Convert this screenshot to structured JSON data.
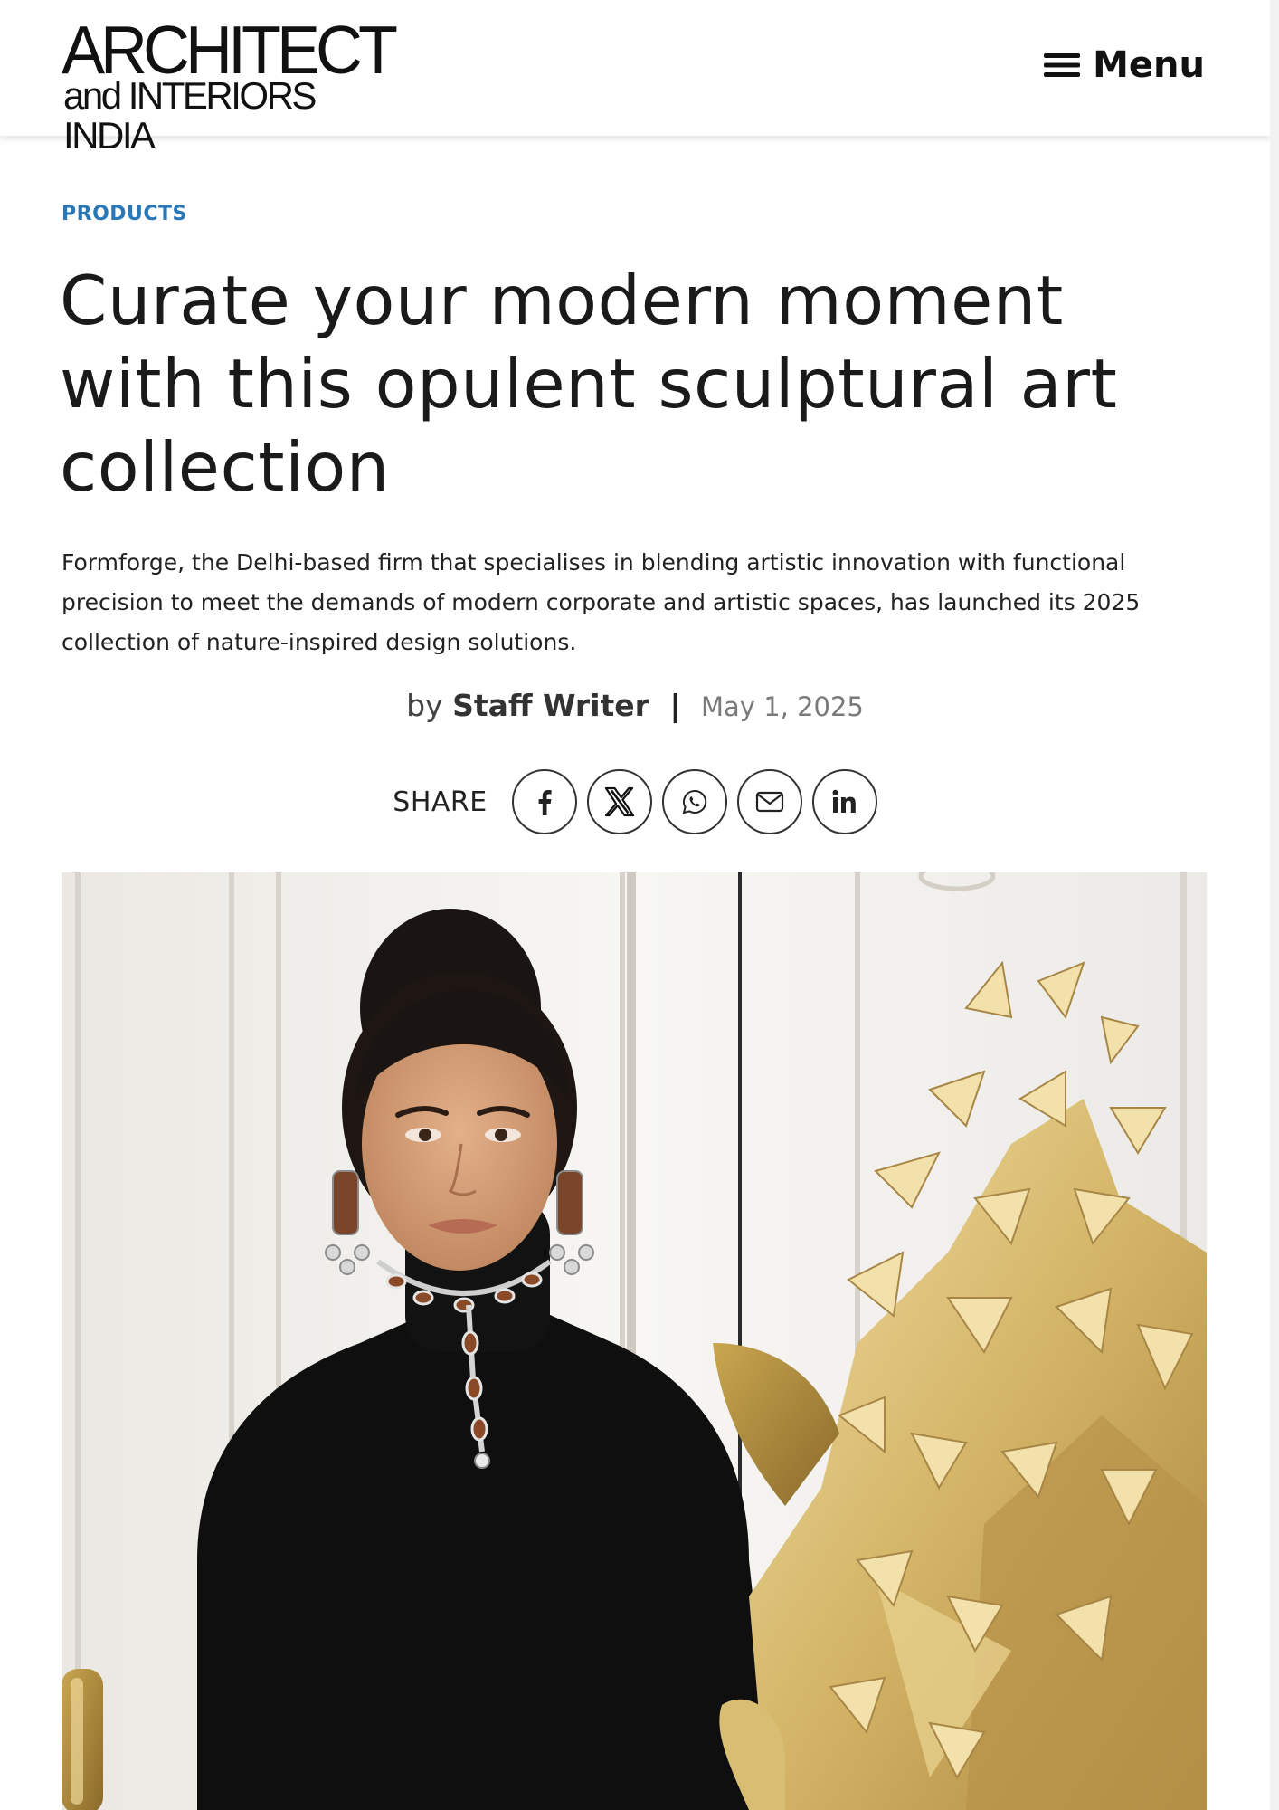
{
  "header": {
    "logo_line_1": "ARCHITECT",
    "logo_line_2": "and INTERIORS INDIA",
    "menu_label": "Menu",
    "menu_icon": "hamburger-icon"
  },
  "article": {
    "category": "PRODUCTS",
    "headline": "Curate your modern moment with this opulent sculptural art collection",
    "dek": "Formforge, the Delhi-based firm that specialises in blending artistic innovation with functional precision to meet the demands of modern corporate and artistic spaces, has launched its 2025 collection of nature-inspired design solutions.",
    "byline_prefix": "by",
    "author": "Staff Writer",
    "separator": "|",
    "date": "May 1, 2025"
  },
  "share": {
    "label": "SHARE",
    "buttons": [
      {
        "name": "facebook",
        "icon": "facebook-icon"
      },
      {
        "name": "x",
        "icon": "x-icon"
      },
      {
        "name": "whatsapp",
        "icon": "whatsapp-icon"
      },
      {
        "name": "email",
        "icon": "email-icon"
      },
      {
        "name": "linkedin",
        "icon": "linkedin-icon"
      }
    ]
  },
  "colors": {
    "category_blue": "#2a77b8",
    "text_dark": "#1a1a1a",
    "date_gray": "#7a7a7a",
    "gold": "#c9a650"
  }
}
